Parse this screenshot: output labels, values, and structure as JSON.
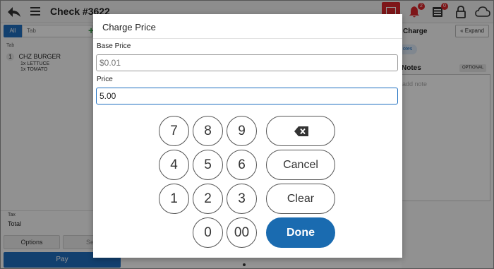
{
  "header": {
    "title": "Check #3622",
    "notifications_count": "2",
    "orders_count": "0"
  },
  "left_panel": {
    "tab_all": "All",
    "tab_tab": "Tab",
    "plus": "+",
    "section_label": "Tab",
    "item": {
      "qty": "1",
      "name": "CHZ BURGER",
      "modifiers": [
        "1x  LETTUCE",
        "1x  TOMATO"
      ]
    },
    "tax_label": "Tax",
    "total_label": "Total",
    "options_label": "Options",
    "second_button_label": "Se",
    "pay_label": "Pay"
  },
  "right_panel": {
    "charge_title": "Charge",
    "expand_label": "« Expand",
    "notes_pill": "otes",
    "notes_title": "Notes",
    "optional_label": "OPTIONAL",
    "notes_placeholder": "add note"
  },
  "modal": {
    "title": "Charge Price",
    "base_price_label": "Base Price",
    "base_price_placeholder": "$0.01",
    "price_label": "Price",
    "price_value": "5.00",
    "keys": {
      "k7": "7",
      "k8": "8",
      "k9": "9",
      "k4": "4",
      "k5": "5",
      "k6": "6",
      "k1": "1",
      "k2": "2",
      "k3": "3",
      "k0": "0",
      "k00": "00"
    },
    "cancel_label": "Cancel",
    "clear_label": "Clear",
    "done_label": "Done"
  },
  "colors": {
    "primary_blue": "#1a6bb0",
    "tab_blue": "#1f6fc0",
    "alert_red": "#d9262b"
  }
}
